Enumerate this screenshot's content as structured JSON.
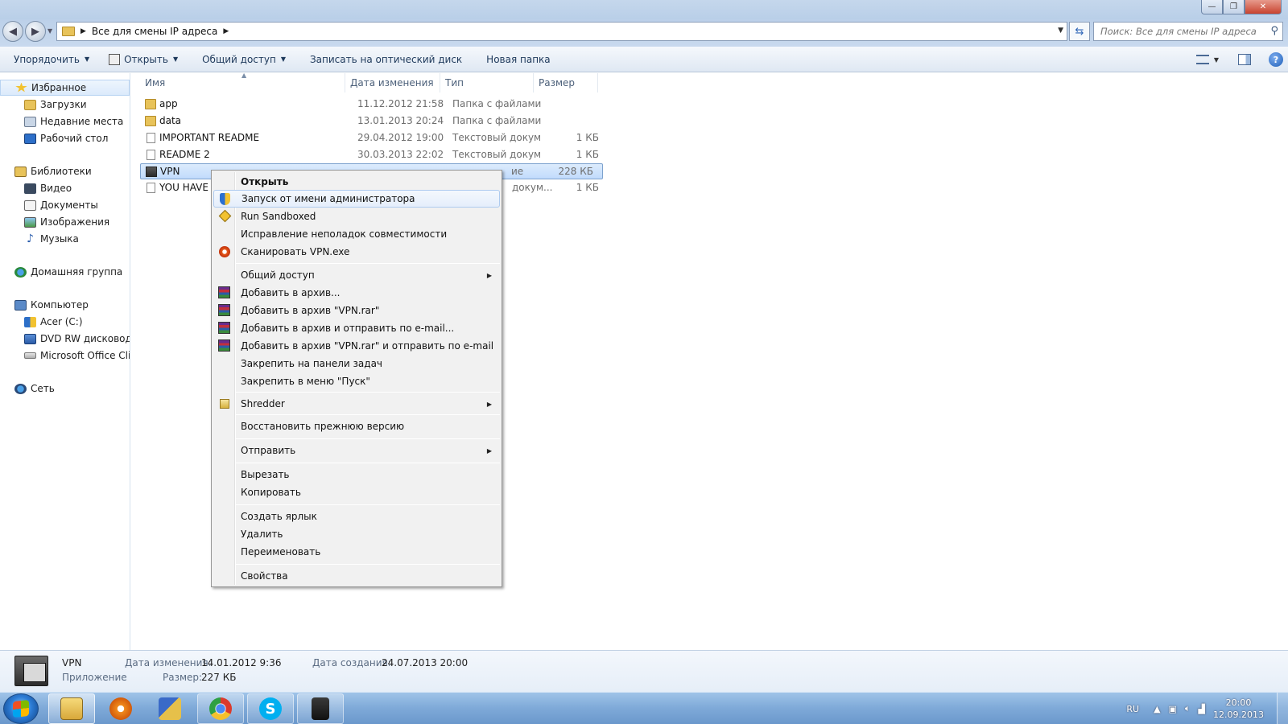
{
  "window": {
    "address": {
      "breadcrumb": "Все для смены IP адреса",
      "search_placeholder": "Поиск: Все для смены IP адреса"
    },
    "buttons": {
      "minimize": "—",
      "maximize": "❐",
      "close": "✕"
    }
  },
  "toolbar": {
    "organize": "Упорядочить",
    "open": "Открыть",
    "share": "Общий доступ",
    "burn": "Записать на оптический диск",
    "new_folder": "Новая папка",
    "help": "?"
  },
  "nav": {
    "favorites": "Избранное",
    "downloads": "Загрузки",
    "recent": "Недавние места",
    "desktop": "Рабочий стол",
    "libraries": "Библиотеки",
    "video": "Видео",
    "documents": "Документы",
    "images": "Изображения",
    "music": "Музыка",
    "homegroup": "Домашняя группа",
    "computer": "Компьютер",
    "drive_c": "Acer (C:)",
    "dvd": "DVD RW дисковод (D",
    "office": "Microsoft Office Clic",
    "network": "Сеть"
  },
  "columns": {
    "name": "Имя",
    "date": "Дата изменения",
    "type": "Тип",
    "size": "Размер"
  },
  "files": [
    {
      "name": "app",
      "date": "11.12.2012 21:58",
      "type": "Папка с файлами",
      "size": "",
      "icon": "folder"
    },
    {
      "name": "data",
      "date": "13.01.2013 20:24",
      "type": "Папка с файлами",
      "size": "",
      "icon": "folder"
    },
    {
      "name": "IMPORTANT README",
      "date": "29.04.2012 19:00",
      "type": "Текстовый докум...",
      "size": "1 КБ",
      "icon": "document"
    },
    {
      "name": "README 2",
      "date": "30.03.2013 22:02",
      "type": "Текстовый докум...",
      "size": "1 КБ",
      "icon": "document"
    },
    {
      "name": "VPN",
      "date": "",
      "type": "ие",
      "size": "228 КБ",
      "icon": "application"
    },
    {
      "name": "YOU HAVE",
      "date": "",
      "type": "докум...",
      "size": "1 КБ",
      "icon": "document"
    }
  ],
  "context_menu": {
    "open": "Открыть",
    "run_as_admin": "Запуск от имени администратора",
    "run_sandboxed": "Run Sandboxed",
    "troubleshoot": "Исправление неполадок совместимости",
    "scan": "Сканировать VPN.exe",
    "share": "Общий доступ",
    "add_archive": "Добавить в архив...",
    "add_vpn_rar": "Добавить в архив \"VPN.rar\"",
    "add_email": "Добавить в архив и отправить по e-mail...",
    "add_vpn_rar_email": "Добавить в архив \"VPN.rar\" и отправить по e-mail",
    "pin_taskbar": "Закрепить на панели задач",
    "pin_start": "Закрепить в меню \"Пуск\"",
    "shredder": "Shredder",
    "restore": "Восстановить прежнюю версию",
    "send_to": "Отправить",
    "cut": "Вырезать",
    "copy": "Копировать",
    "shortcut": "Создать ярлык",
    "delete": "Удалить",
    "rename": "Переименовать",
    "properties": "Свойства"
  },
  "details": {
    "name": "VPN",
    "kind": "Приложение",
    "modified_label": "Дата изменения:",
    "modified": "14.01.2012 9:36",
    "size_label": "Размер:",
    "size": "227 КБ",
    "created_label": "Дата создания:",
    "created": "24.07.2013 20:00"
  },
  "taskbar": {
    "lang": "RU",
    "time": "20:00",
    "date": "12.09.2013",
    "skype_letter": "S"
  }
}
